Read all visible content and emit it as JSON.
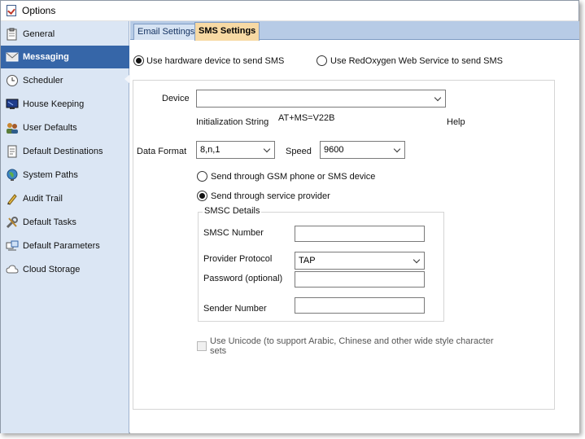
{
  "window": {
    "title": "Options"
  },
  "sidebar": {
    "items": [
      {
        "label": "General",
        "icon": "general-icon",
        "active": false
      },
      {
        "label": "Messaging",
        "icon": "messaging-icon",
        "active": true
      },
      {
        "label": "Scheduler",
        "icon": "clock-icon",
        "active": false
      },
      {
        "label": "House Keeping",
        "icon": "monitor-icon",
        "active": false
      },
      {
        "label": "User Defaults",
        "icon": "users-icon",
        "active": false
      },
      {
        "label": "Default Destinations",
        "icon": "document-icon",
        "active": false
      },
      {
        "label": "System Paths",
        "icon": "globe-icon",
        "active": false
      },
      {
        "label": "Audit Trail",
        "icon": "pen-icon",
        "active": false
      },
      {
        "label": "Default Tasks",
        "icon": "tools-icon",
        "active": false
      },
      {
        "label": "Default Parameters",
        "icon": "parameters-icon",
        "active": false
      },
      {
        "label": "Cloud Storage",
        "icon": "cloud-icon",
        "active": false
      }
    ]
  },
  "tabs": [
    {
      "label": "Email Settings",
      "active": false
    },
    {
      "label": "SMS Settings",
      "active": true
    }
  ],
  "sms": {
    "mode_hardware_label": "Use hardware device to send SMS",
    "mode_redoxygen_label": "Use RedOxygen Web Service  to send SMS",
    "selected_mode": "hardware",
    "device_label": "Device",
    "device_value": "",
    "init_string_label": "Initialization String",
    "init_string_value": "AT+MS=V22B",
    "help_label": "Help",
    "data_format_label": "Data Format",
    "data_format_value": "8,n,1",
    "speed_label": "Speed",
    "speed_value": "9600",
    "send_gsm_label": "Send through GSM phone or SMS device",
    "send_provider_label": "Send through service provider",
    "selected_send": "provider",
    "smsc": {
      "legend": "SMSC Details",
      "number_label": "SMSC Number",
      "number_value": "",
      "protocol_label": "Provider Protocol",
      "protocol_value": "TAP",
      "password_label": "Password (optional)",
      "password_value": "",
      "sender_label": "Sender Number",
      "sender_value": ""
    },
    "unicode_line1": "Use Unicode (to support Arabic, Chinese and other wide style character",
    "unicode_line2": "sets",
    "unicode_checked": false
  }
}
